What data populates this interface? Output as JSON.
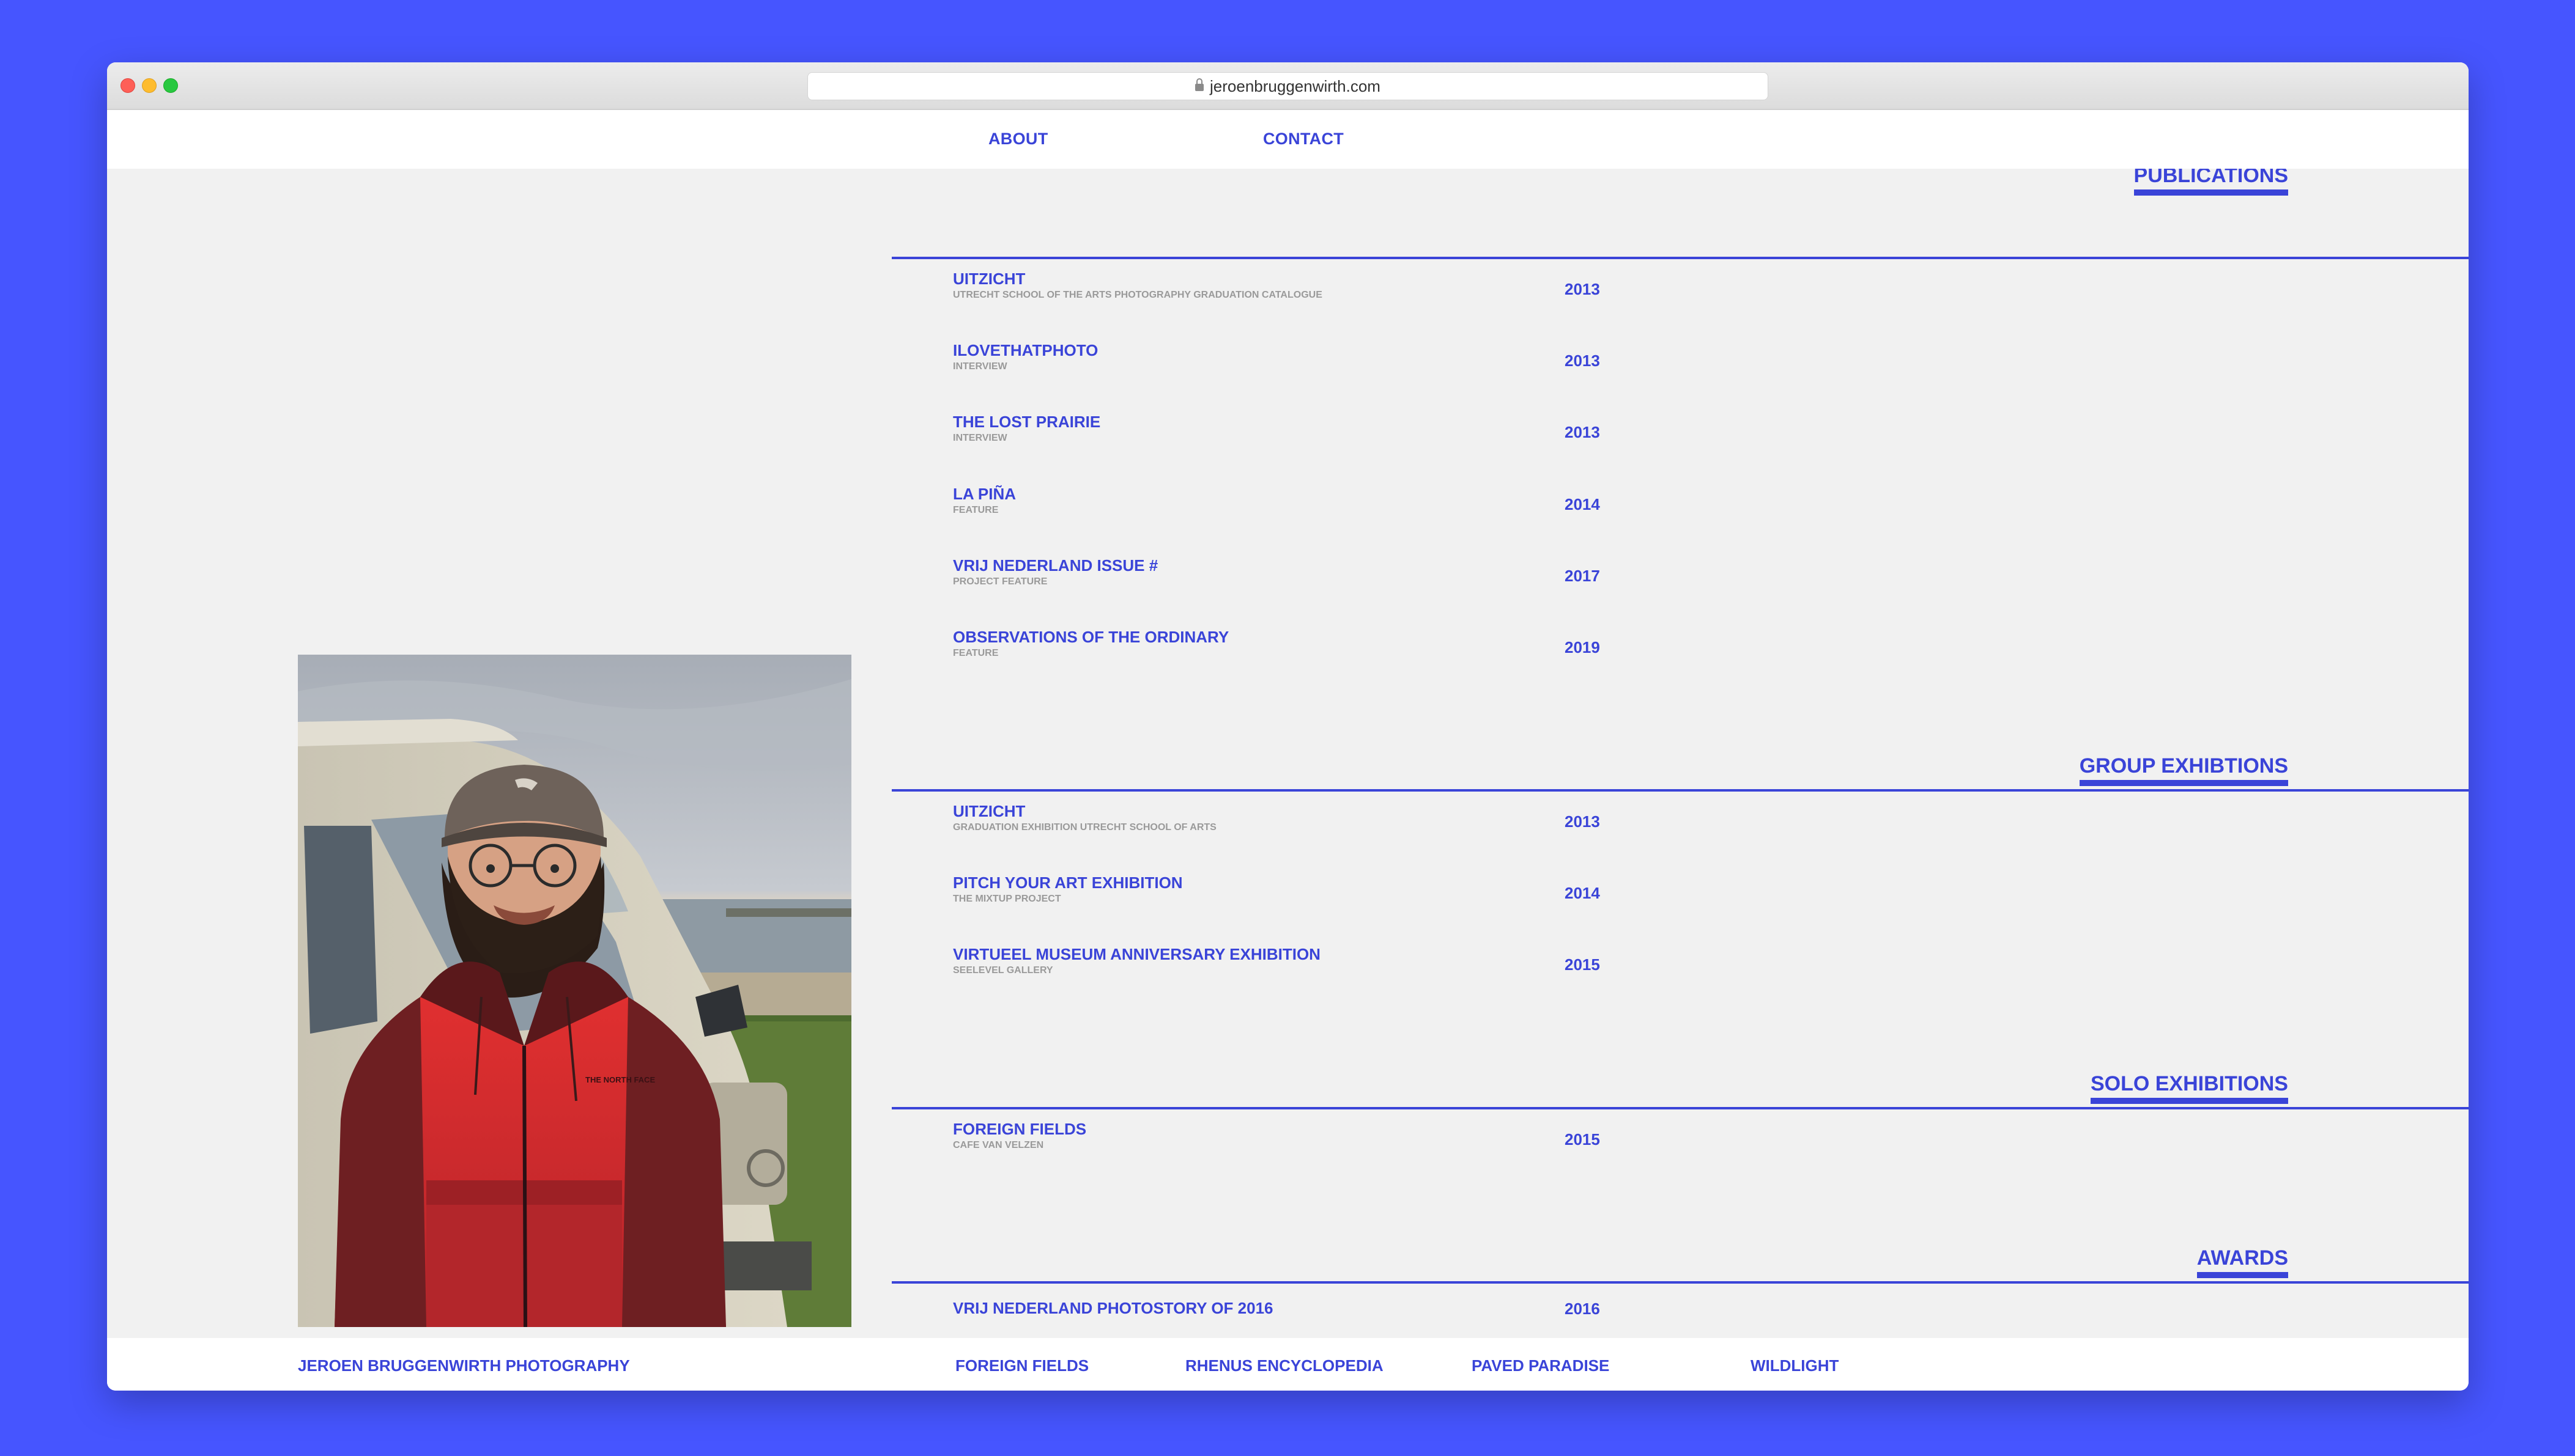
{
  "browser": {
    "url": "jeroenbruggenwirth.com"
  },
  "topnav": {
    "about": "ABOUT",
    "contact": "CONTACT"
  },
  "publications": {
    "heading": "PUBLICATIONS",
    "items": [
      {
        "title": "UITZICHT",
        "sub": "UTRECHT SCHOOL OF THE ARTS PHOTOGRAPHY GRADUATION CATALOGUE",
        "year": "2013"
      },
      {
        "title": "ILOVETHATPHOTO",
        "sub": "INTERVIEW",
        "year": "2013"
      },
      {
        "title": "THE LOST PRAIRIE",
        "sub": "INTERVIEW",
        "year": "2013"
      },
      {
        "title": "LA PIÑA",
        "sub": "FEATURE",
        "year": "2014"
      },
      {
        "title": "VRIJ NEDERLAND ISSUE #",
        "sub": "PROJECT FEATURE",
        "year": "2017"
      },
      {
        "title": "OBSERVATIONS OF THE ORDINARY",
        "sub": "FEATURE",
        "year": "2019"
      }
    ]
  },
  "group_exhibitions": {
    "heading": "GROUP EXHIBTIONS",
    "items": [
      {
        "title": "UITZICHT",
        "sub": "GRADUATION EXHIBITION UTRECHT SCHOOL OF ARTS",
        "year": "2013"
      },
      {
        "title": "PITCH YOUR ART EXHIBITION",
        "sub": "THE MIXTUP PROJECT",
        "year": "2014"
      },
      {
        "title": "VIRTUEEL MUSEUM ANNIVERSARY EXHIBITION",
        "sub": "SEELEVEL GALLERY",
        "year": "2015"
      }
    ]
  },
  "solo_exhibitions": {
    "heading": "SOLO EXHIBITIONS",
    "items": [
      {
        "title": "FOREIGN FIELDS",
        "sub": "CAFE VAN VELZEN",
        "year": "2015"
      }
    ]
  },
  "awards": {
    "heading": "AWARDS",
    "items": [
      {
        "title": "VRIJ NEDERLAND PHOTOSTORY OF 2016",
        "sub": "",
        "year": "2016"
      }
    ]
  },
  "photo": {
    "logo_text": "THE NORTH FACE"
  },
  "footer": {
    "brand": "JEROEN BRUGGENWIRTH PHOTOGRAPHY",
    "links": [
      "FOREIGN FIELDS",
      "RHENUS ENCYCLOPEDIA",
      "PAVED PARADISE",
      "WILDLIGHT"
    ]
  },
  "colors": {
    "background": "#4655ff",
    "accent": "#3a44d8",
    "page": "#f1f1f1",
    "muted_text": "#9a9a9a"
  }
}
